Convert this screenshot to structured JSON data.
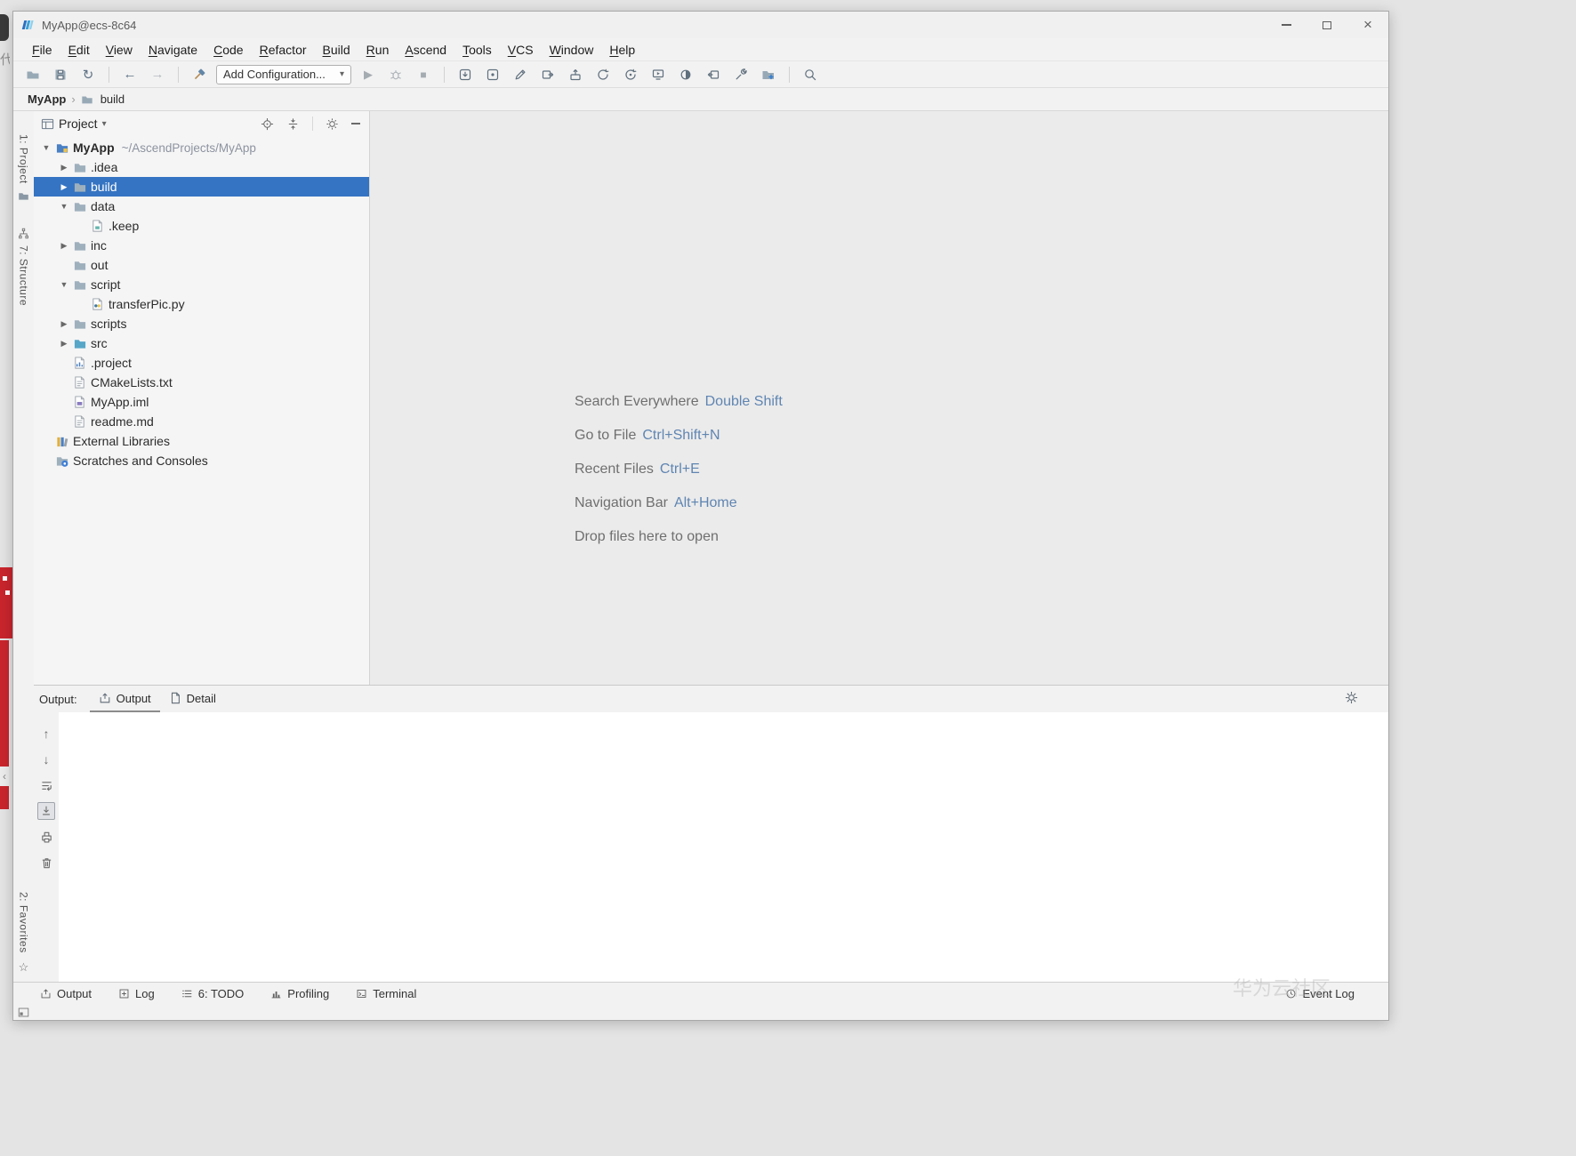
{
  "window": {
    "title": "MyApp@ecs-8c64"
  },
  "menu": {
    "items": [
      "File",
      "Edit",
      "View",
      "Navigate",
      "Code",
      "Refactor",
      "Build",
      "Run",
      "Ascend",
      "Tools",
      "VCS",
      "Window",
      "Help"
    ]
  },
  "toolbar": {
    "run_config_label": "Add Configuration..."
  },
  "breadcrumb": {
    "items": [
      "MyApp",
      "build"
    ]
  },
  "left_stripe": {
    "project_label": "1: Project",
    "structure_label": "7: Structure",
    "favorites_label": "2: Favorites"
  },
  "project_panel": {
    "title": "Project",
    "tree": [
      {
        "indent": 0,
        "arrow": "down",
        "icon": "project-folder",
        "label": "MyApp",
        "suffix": "~/AscendProjects/MyApp",
        "bold": true,
        "selected": false
      },
      {
        "indent": 1,
        "arrow": "right",
        "icon": "folder",
        "label": ".idea",
        "suffix": "",
        "bold": false,
        "selected": false
      },
      {
        "indent": 1,
        "arrow": "right",
        "icon": "folder",
        "label": "build",
        "suffix": "",
        "bold": false,
        "selected": true
      },
      {
        "indent": 1,
        "arrow": "down",
        "icon": "folder",
        "label": "data",
        "suffix": "",
        "bold": false,
        "selected": false
      },
      {
        "indent": 2,
        "arrow": "none",
        "icon": "keep-file",
        "label": ".keep",
        "suffix": "",
        "bold": false,
        "selected": false
      },
      {
        "indent": 1,
        "arrow": "right",
        "icon": "folder",
        "label": "inc",
        "suffix": "",
        "bold": false,
        "selected": false
      },
      {
        "indent": 1,
        "arrow": "none",
        "icon": "folder",
        "label": "out",
        "suffix": "",
        "bold": false,
        "selected": false
      },
      {
        "indent": 1,
        "arrow": "down",
        "icon": "folder",
        "label": "script",
        "suffix": "",
        "bold": false,
        "selected": false
      },
      {
        "indent": 2,
        "arrow": "none",
        "icon": "python-file",
        "label": "transferPic.py",
        "suffix": "",
        "bold": false,
        "selected": false
      },
      {
        "indent": 1,
        "arrow": "right",
        "icon": "folder",
        "label": "scripts",
        "suffix": "",
        "bold": false,
        "selected": false
      },
      {
        "indent": 1,
        "arrow": "right",
        "icon": "src-folder",
        "label": "src",
        "suffix": "",
        "bold": false,
        "selected": false
      },
      {
        "indent": 1,
        "arrow": "none",
        "icon": "chart-file",
        "label": ".project",
        "suffix": "",
        "bold": false,
        "selected": false
      },
      {
        "indent": 1,
        "arrow": "none",
        "icon": "text-file",
        "label": "CMakeLists.txt",
        "suffix": "",
        "bold": false,
        "selected": false
      },
      {
        "indent": 1,
        "arrow": "none",
        "icon": "iml-file",
        "label": "MyApp.iml",
        "suffix": "",
        "bold": false,
        "selected": false
      },
      {
        "indent": 1,
        "arrow": "none",
        "icon": "text-file",
        "label": "readme.md",
        "suffix": "",
        "bold": false,
        "selected": false
      },
      {
        "indent": 0,
        "arrow": "none",
        "icon": "libraries",
        "label": "External Libraries",
        "suffix": "",
        "bold": false,
        "selected": false
      },
      {
        "indent": 0,
        "arrow": "none",
        "icon": "scratches-folder",
        "label": "Scratches and Consoles",
        "suffix": "",
        "bold": false,
        "selected": false
      }
    ]
  },
  "editor": {
    "hints": [
      {
        "label": "Search Everywhere",
        "shortcut": "Double Shift"
      },
      {
        "label": "Go to File",
        "shortcut": "Ctrl+Shift+N"
      },
      {
        "label": "Recent Files",
        "shortcut": "Ctrl+E"
      },
      {
        "label": "Navigation Bar",
        "shortcut": "Alt+Home"
      },
      {
        "label": "Drop files here to open",
        "shortcut": ""
      }
    ]
  },
  "output_panel": {
    "label": "Output:",
    "tabs": [
      {
        "label": "Output",
        "selected": true
      },
      {
        "label": "Detail",
        "selected": false
      }
    ]
  },
  "bottom_bar": {
    "tabs": [
      {
        "label": "Output"
      },
      {
        "label": "Log"
      },
      {
        "label": "6: TODO"
      },
      {
        "label": "Profiling"
      },
      {
        "label": "Terminal"
      }
    ],
    "event_log": "Event Log"
  },
  "icons": {
    "chevron_down": "▼",
    "chevron_right": "▶",
    "dropdown_caret": "▾",
    "breadcrumb_separator": "›",
    "up_arrow": "↑",
    "down_arrow": "↓",
    "back_arrow": "←",
    "forward_arrow": "→",
    "sync": "↻",
    "run": "▶",
    "stop": "■",
    "star": "☆",
    "close": "×",
    "notch_chevron": "‹"
  },
  "desktop": {
    "fragment_char": "代",
    "watermark": "华为云社区"
  },
  "colors": {
    "selection_blue": "#3574c2",
    "shortcut_blue": "#5f85b2",
    "banner_red": "#c9252d"
  }
}
